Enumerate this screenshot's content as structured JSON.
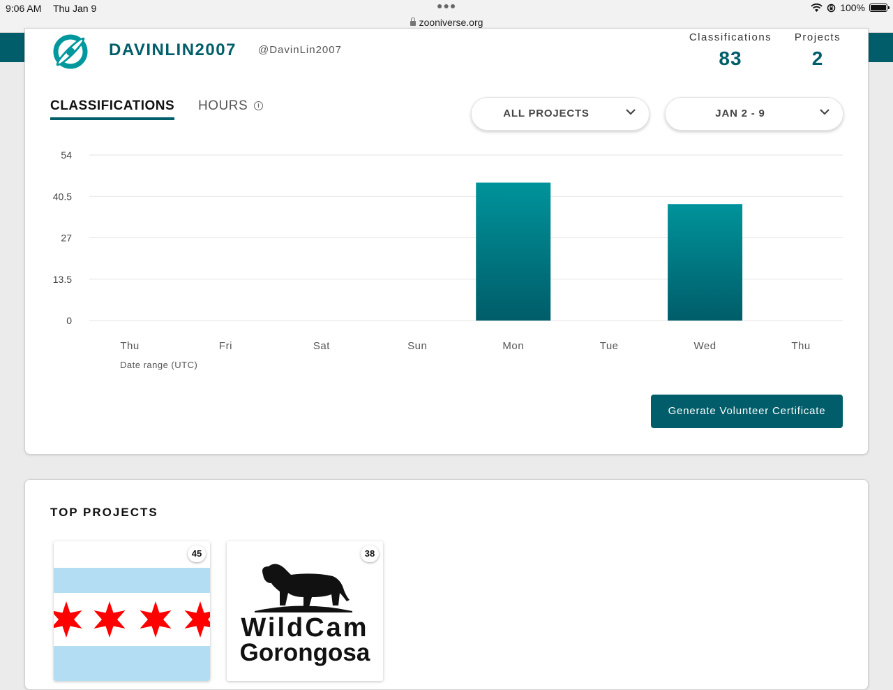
{
  "status_bar": {
    "time": "9:06 AM",
    "date": "Thu Jan 9",
    "url": "zooniverse.org",
    "battery": "100%"
  },
  "profile": {
    "display_name": "DAVINLIN2007",
    "handle": "@DavinLin2007"
  },
  "stats": {
    "classifications_label": "Classifications",
    "classifications_value": "83",
    "projects_label": "Projects",
    "projects_value": "2"
  },
  "tabs": {
    "classifications": "CLASSIFICATIONS",
    "hours": "HOURS"
  },
  "filters": {
    "project": "ALL PROJECTS",
    "date_range": "JAN 2 - 9"
  },
  "chart_data": {
    "type": "bar",
    "categories": [
      "Thu",
      "Fri",
      "Sat",
      "Sun",
      "Mon",
      "Tue",
      "Wed",
      "Thu"
    ],
    "values": [
      0,
      0,
      0,
      0,
      45,
      0,
      38,
      0
    ],
    "yticks": [
      "0",
      "13.5",
      "27",
      "40.5",
      "54"
    ],
    "ylim": [
      0,
      54
    ],
    "xlabel": "Date range (UTC)",
    "ylabel": "",
    "grid": true,
    "bar_color_top": "#00939b",
    "bar_color_bottom": "#005d69"
  },
  "certificate_button": "Generate Volunteer Certificate",
  "top_projects": {
    "title": "TOP PROJECTS",
    "items": [
      {
        "name": "Chicago",
        "count": "45"
      },
      {
        "name": "WildCam Gorongosa",
        "count": "38",
        "logo_line1": "WildCam",
        "logo_line2": "Gorongosa"
      }
    ]
  },
  "colors": {
    "brand": "#005d69",
    "star_red": "#ff0000",
    "flag_blue": "#b3ddf2"
  }
}
